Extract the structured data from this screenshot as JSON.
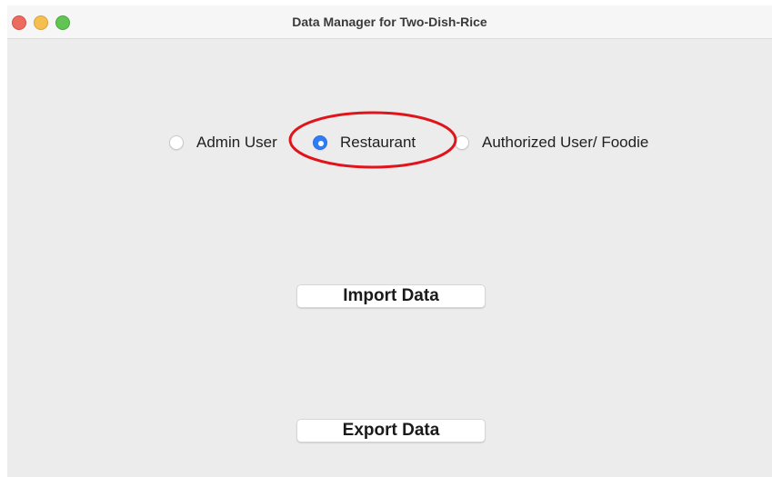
{
  "window": {
    "title": "Data Manager for Two-Dish-Rice"
  },
  "radio_group": {
    "options": [
      {
        "label": "Admin User",
        "checked": false
      },
      {
        "label": "Restaurant",
        "checked": true
      },
      {
        "label": "Authorized User/ Foodie",
        "checked": false
      }
    ]
  },
  "buttons": {
    "import_label": "Import Data",
    "export_label": "Export Data"
  },
  "annotation": {
    "shape": "ellipse",
    "color": "#e0151b",
    "target": "Restaurant"
  },
  "colors": {
    "accent": "#2f7df6",
    "close": "#ed6a5e",
    "minimize": "#f5bf4f",
    "zoom": "#61c554"
  }
}
